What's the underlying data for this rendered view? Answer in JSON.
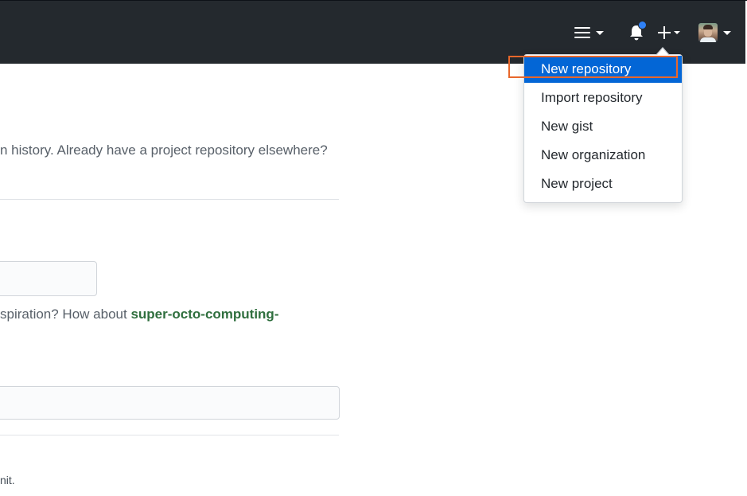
{
  "header": {
    "nav_icons": [
      "hamburger-icon",
      "bell-icon",
      "plus-icon",
      "avatar"
    ],
    "notification_dot_color": "#2f81f7",
    "background_color": "#24292e"
  },
  "main": {
    "intro_text": "n history. Already have a project repository elsewhere?",
    "name_suggestion_prefix": "spiration? How about ",
    "name_suggestion_value": "super-octo-computing-",
    "footer_fragment": "nit."
  },
  "create_menu": {
    "items": [
      {
        "label": "New repository",
        "active": true
      },
      {
        "label": "Import repository",
        "active": false
      },
      {
        "label": "New gist",
        "active": false
      },
      {
        "label": "New organization",
        "active": false
      },
      {
        "label": "New project",
        "active": false
      }
    ],
    "active_color": "#0366d6",
    "highlight_color": "#e8672a"
  }
}
